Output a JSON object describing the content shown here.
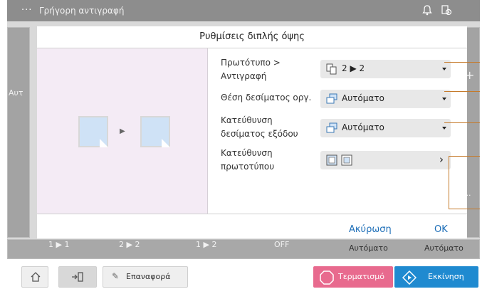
{
  "header": {
    "title": "Γρήγορη αντιγραφή",
    "menu_glyph": "···",
    "icons": [
      "bell-icon",
      "job-icon"
    ]
  },
  "background": {
    "left_label": "Αυτ",
    "bottom_values": [
      "1 ▶ 1",
      "2 ▶ 2",
      "1 ▶ 2",
      "OFF",
      "Αυτόματο",
      "Αυτόματο"
    ],
    "plus_glyph": "+",
    "ellipsis": "..."
  },
  "modal": {
    "title": "Ρυθμίσεις διπλής όψης",
    "rows": [
      {
        "label_line1": "Πρωτότυπο >",
        "label_line2": "Αντιγραφή",
        "value": "2 ▶ 2",
        "icon": "duplex-icon",
        "control": "dropdown"
      },
      {
        "label_line1": "Θέση δεσίματος οργ.",
        "label_line2": "",
        "value": "Αυτόματο",
        "icon": "binding-icon",
        "control": "dropdown"
      },
      {
        "label_line1": "Κατεύθυνση",
        "label_line2": "δεσίματος εξόδου",
        "value": "Αυτόματο",
        "icon": "binding-icon",
        "control": "dropdown"
      },
      {
        "label_line1": "Κατεύθυνση",
        "label_line2": "πρωτοτύπου",
        "value": "",
        "icon": "orientation-icon",
        "control": "chevron"
      }
    ],
    "cancel_label": "Ακύρωση",
    "ok_label": "OK"
  },
  "bottom_bar": {
    "reset_label": "Επαναφορά",
    "stop_label": "Τερματισμό",
    "start_label": "Εκκίνηση"
  },
  "colors": {
    "accent_blue": "#1f8ad0",
    "stop_pink": "#e86a8e",
    "callout_orange": "#c57a2a",
    "preview_bg": "#f4ebf5"
  }
}
